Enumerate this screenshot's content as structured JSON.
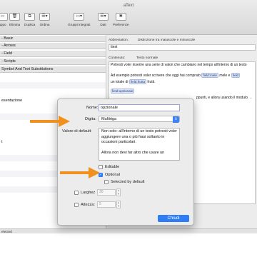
{
  "window": {
    "title": "aText"
  },
  "toolbar": {
    "items": [
      {
        "label": "uppo",
        "icon": "folder-icon"
      },
      {
        "label": "Elimina",
        "icon": "trash-icon"
      },
      {
        "label": "Duplica",
        "icon": "duplicate-icon"
      },
      {
        "label": "Ordina",
        "icon": "sort-icon"
      },
      {
        "label": "Gruppi integrati",
        "icon": "folder-icon"
      },
      {
        "label": "Dati",
        "icon": "list-icon"
      },
      {
        "label": "Preferenze",
        "icon": "gear-icon"
      }
    ]
  },
  "left_list": {
    "rows": [
      {
        "label": "- Basic"
      },
      {
        "label": "- Arrows"
      },
      {
        "label": "- Field"
      },
      {
        "label": "- Scripts"
      },
      {
        "label": "Symbol And Text Substitutions"
      },
      {
        "label": "esentazione"
      },
      {
        "label": "t"
      }
    ]
  },
  "detail": {
    "abbrev_label": "Abbreviation:",
    "abbrev_mode": "Distinzione tra maiuscole e minuscole",
    "abbrev_value": "ttest",
    "content_label": "Contenuto:",
    "content_mode": "Testo normale",
    "line1": "Potresti voler inserire una serie di valori che cambiano nel tempo all'interno di un testo",
    "line2": "Ad esempio potresti voler scrivere che oggi hai comprato",
    "token_mele": "field:mele",
    "line2b": "mele e",
    "token_field": "field",
    "line3": "un totale di",
    "token_frutta": "field:frutta",
    "line3b": "frutti.",
    "token_opzionale": "field:opzionale",
    "line4": "ppunti, e allora usando il modulo →"
  },
  "status": {
    "text": "elected"
  },
  "sheet": {
    "name_label": "Nome:",
    "name_value": "opzionale",
    "type_label": "Digita:",
    "type_value": "Multiriga",
    "default_label": "Valore di default:",
    "default_text": "Non solo: all'interno di un testo potresti voler aggiungere una o più frasi soltanto in occasioni particolari.\n\nAllora non devi far altro che usare un",
    "editable_label": "Editable",
    "optional_label": "Optional",
    "selected_label": "Selected by default",
    "width_label": "Larghez",
    "width_value": "30",
    "height_label": "Altezza:",
    "height_value": "5",
    "ok_label": "Chiudi"
  },
  "colors": {
    "accent": "#2f7cf6",
    "arrow": "#f0901e"
  }
}
